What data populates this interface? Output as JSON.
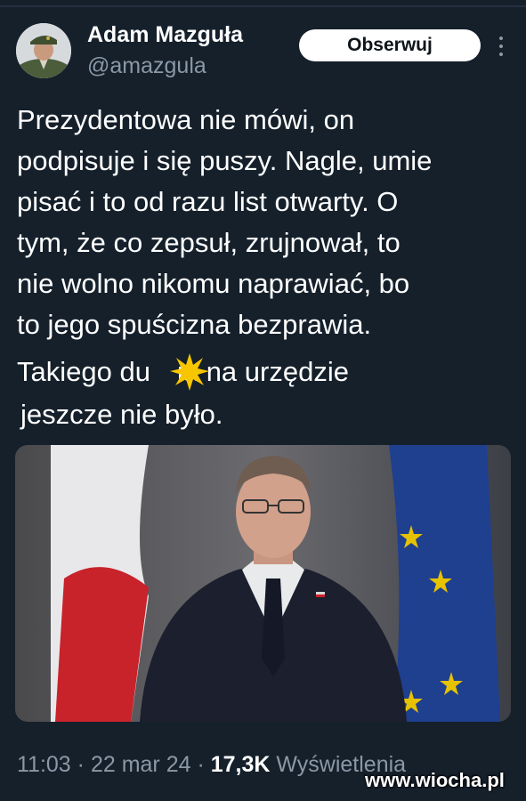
{
  "author": {
    "display_name": "Adam Mazguła",
    "handle": "@amazgula"
  },
  "follow_button": {
    "label": "Obserwuj"
  },
  "tweet": {
    "lines": [
      "Prezydentowa nie mówi, on",
      "podpisuje i się puszy. Nagle, umie",
      "pisać i to od razu list otwarty. O",
      "tym, że co zepsuł, zrujnował, to",
      "nie wolno nikomu naprawiać, bo",
      "to jego spuścizna bezprawia."
    ]
  },
  "caption": {
    "line1_before": "Takiego du",
    "line1_after": "ia na urzędzie",
    "line2": "jeszcze nie było."
  },
  "meta": {
    "time": "11:03",
    "separator": "·",
    "date": "22 mar 24",
    "views_count": "17,3K",
    "views_label": "Wyświetlenia"
  },
  "watermark": {
    "text": "www.wiocha.pl"
  },
  "colors": {
    "background": "#15202b",
    "text_primary": "#ffffff",
    "text_secondary": "#8b98a5",
    "censor_star": "#f7c600",
    "follow_button_bg": "#ffffff"
  },
  "icons": {
    "more": "more-vertical-icon",
    "censor": "star-icon"
  }
}
